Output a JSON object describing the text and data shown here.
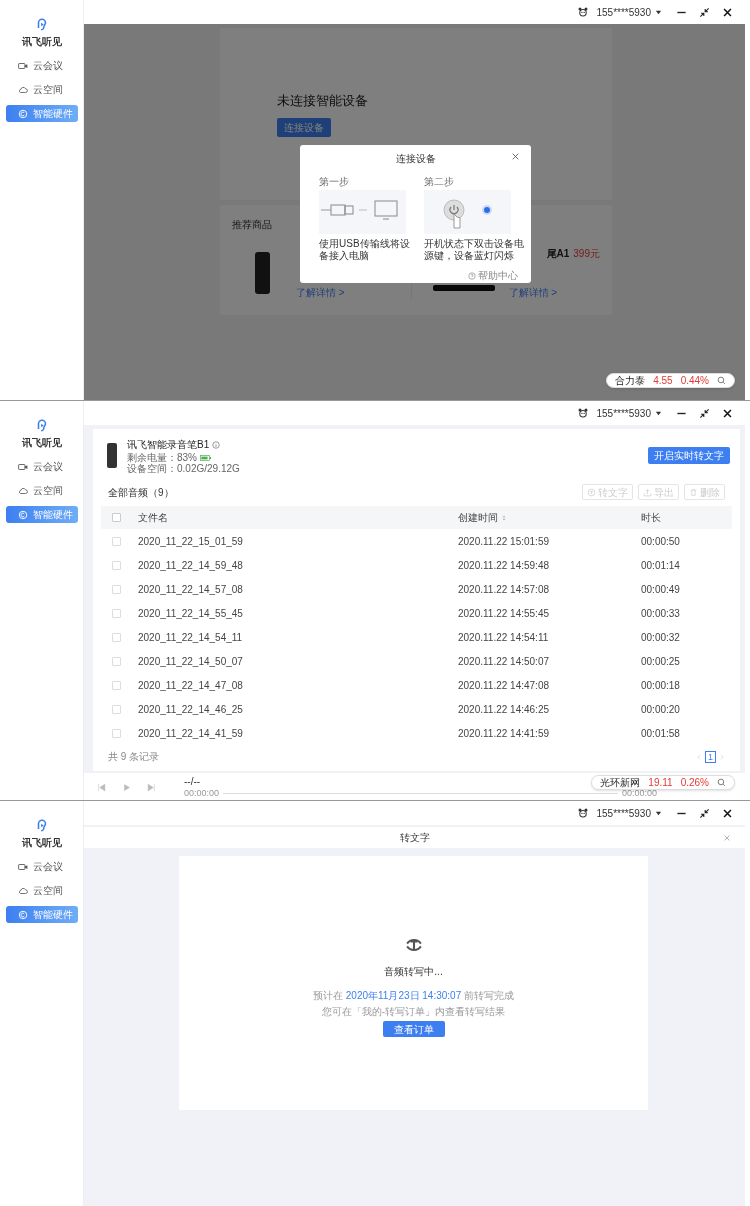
{
  "screens": [
    {
      "kind": "connect",
      "sidebar": {
        "logo": "讯飞听见",
        "items": [
          {
            "label": "云会议",
            "selected": false
          },
          {
            "label": "云空间",
            "selected": false
          },
          {
            "label": "智能硬件",
            "selected": true
          }
        ]
      },
      "top_bar": {
        "account": "155****5930"
      },
      "title": "未连接智能设备",
      "connect_button": "连接设备",
      "recommend": {
        "title": "推荐商品",
        "products": [
          {
            "link": "了解详情 >"
          },
          {
            "name": "尾A1",
            "price": "399元",
            "link": "了解详情 >"
          }
        ]
      },
      "dialog": {
        "title": "连接设备",
        "steps": [
          {
            "label": "第一步",
            "text": "使用USB传输线将设备接入电脑"
          },
          {
            "label": "第二步",
            "text": "开机状态下双击设备电源键，设备蓝灯闪烁"
          }
        ],
        "help": "帮助中心"
      },
      "ticker": {
        "name": "合力泰",
        "price": "4.55",
        "change": "0.44%"
      }
    },
    {
      "kind": "device",
      "sidebar": {
        "logo": "讯飞听见",
        "items": [
          {
            "label": "云会议",
            "selected": false
          },
          {
            "label": "云空间",
            "selected": false
          },
          {
            "label": "智能硬件",
            "selected": true
          }
        ]
      },
      "top_bar": {
        "account": "155****5930"
      },
      "device": {
        "name": "讯飞智能录音笔B1",
        "battery": "剩余电量：83%",
        "storage": "设备空间：0.02G/29.12G"
      },
      "realtime_button": "开启实时转文字",
      "list_title": "全部音频（9）",
      "actions": [
        {
          "label": "转文字",
          "disabled": true
        },
        {
          "label": "导出",
          "disabled": true
        },
        {
          "label": "删除",
          "disabled": true
        }
      ],
      "table": {
        "select_all": {
          "checked": false
        },
        "columns": [
          "文件名",
          "创建时间",
          "时长"
        ],
        "rows": [
          {
            "checked": false,
            "cells": [
              "2020_11_22_15_01_59",
              "2020.11.22 15:01:59",
              "00:00:50"
            ]
          },
          {
            "checked": false,
            "cells": [
              "2020_11_22_14_59_48",
              "2020.11.22 14:59:48",
              "00:01:14"
            ]
          },
          {
            "checked": false,
            "cells": [
              "2020_11_22_14_57_08",
              "2020.11.22 14:57:08",
              "00:00:49"
            ]
          },
          {
            "checked": false,
            "cells": [
              "2020_11_22_14_55_45",
              "2020.11.22 14:55:45",
              "00:00:33"
            ]
          },
          {
            "checked": false,
            "cells": [
              "2020_11_22_14_54_11",
              "2020.11.22 14:54:11",
              "00:00:32"
            ]
          },
          {
            "checked": false,
            "cells": [
              "2020_11_22_14_50_07",
              "2020.11.22 14:50:07",
              "00:00:25"
            ]
          },
          {
            "checked": false,
            "cells": [
              "2020_11_22_14_47_08",
              "2020.11.22 14:47:08",
              "00:00:18"
            ]
          },
          {
            "checked": false,
            "cells": [
              "2020_11_22_14_46_25",
              "2020.11.22 14:46:25",
              "00:00:20"
            ]
          },
          {
            "checked": false,
            "cells": [
              "2020_11_22_14_41_59",
              "2020.11.22 14:41:59",
              "00:01:58"
            ]
          }
        ]
      },
      "total": "共 9 条记录",
      "pages": [
        {
          "label": "1",
          "selected": true
        }
      ],
      "player": {
        "track": "--/--",
        "elapsed": "00:00:00",
        "duration": "00:00:00"
      },
      "ticker": {
        "name": "光环新网",
        "price": "19.11",
        "change": "0.26%"
      }
    },
    {
      "kind": "transcribe",
      "sidebar": {
        "logo": "讯飞听见",
        "items": [
          {
            "label": "云会议",
            "selected": false
          },
          {
            "label": "云空间",
            "selected": false
          },
          {
            "label": "智能硬件",
            "selected": true
          }
        ]
      },
      "top_bar": {
        "account": "155****5930"
      },
      "title": "转文字",
      "status": "音频转写中...",
      "estimate": {
        "before": "预计在",
        "time": "2020年11月23日 14:30:07",
        "after": "前转写完成"
      },
      "hint": "您可在「我的-转写订单」内查看转写结果",
      "order_button": "查看订单"
    }
  ]
}
